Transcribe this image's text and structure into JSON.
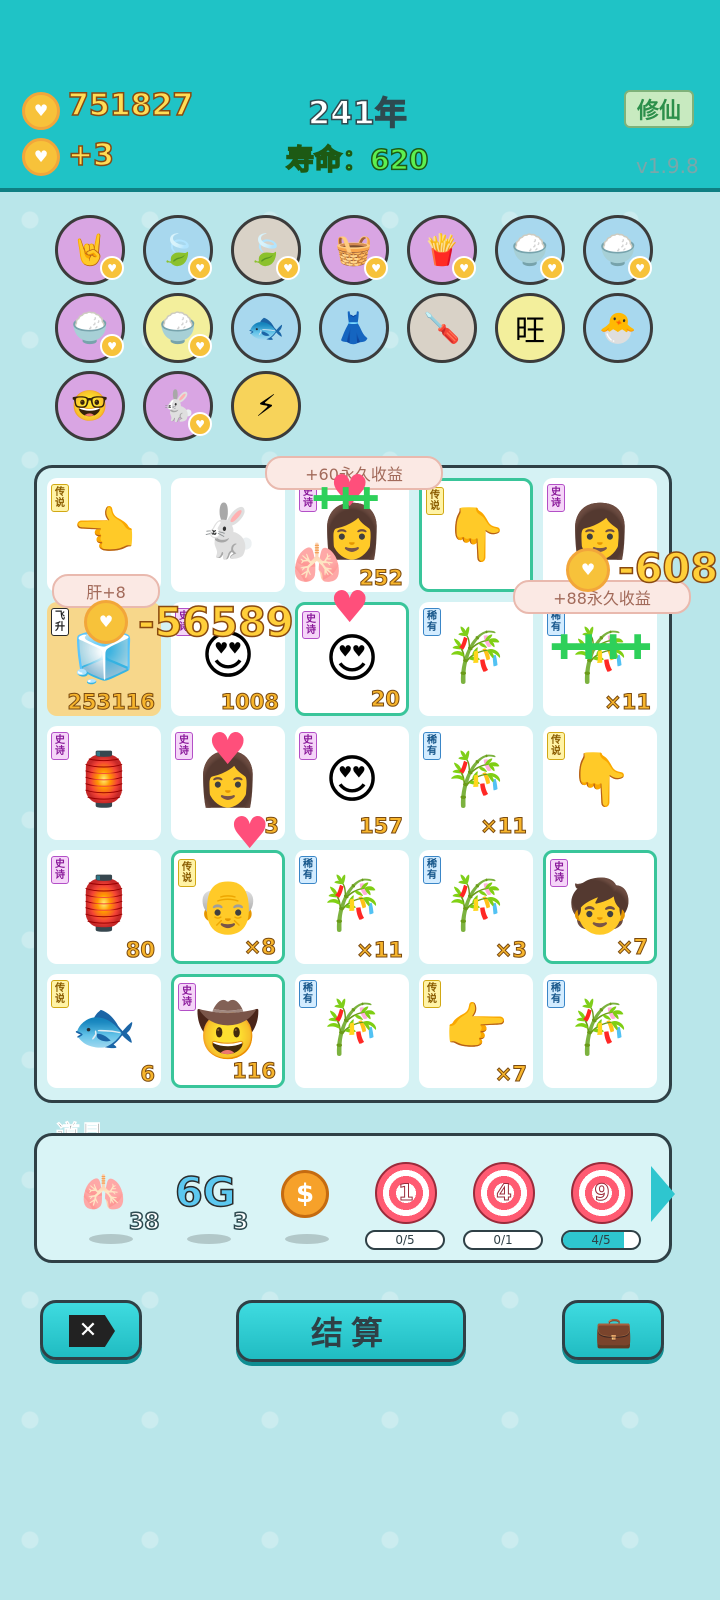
{
  "header": {
    "coins": "751827",
    "income": "+3",
    "year": "241年",
    "life_label": "寿命：",
    "life_value": "620",
    "mode_button": "修仙",
    "version": "v1.9.8"
  },
  "items": [
    {
      "icon": "rock-hand-icon",
      "glyph": "🤘",
      "bg": "#d9a5e3"
    },
    {
      "icon": "leaf-icon",
      "glyph": "🍃",
      "bg": "#a8d8ee"
    },
    {
      "icon": "leaf-icon",
      "glyph": "🍃",
      "bg": "#d9d2c7"
    },
    {
      "icon": "fruit-basket-icon",
      "glyph": "🧺",
      "bg": "#d9a5e3"
    },
    {
      "icon": "fries-icon",
      "glyph": "🍟",
      "bg": "#d9a5e3"
    },
    {
      "icon": "rice-bowl-icon",
      "glyph": "🍚",
      "bg": "#a8d8ee"
    },
    {
      "icon": "rice-bowl-icon",
      "glyph": "🍚",
      "bg": "#a8d8ee"
    },
    {
      "icon": "rice-bowl-icon",
      "glyph": "🍚",
      "bg": "#d9a5e3"
    },
    {
      "icon": "rice-bowl-icon",
      "glyph": "🍚",
      "bg": "#f3ef9c"
    },
    {
      "icon": "fish-tank-icon",
      "glyph": "🐟",
      "bg": "#a8d8ee"
    },
    {
      "icon": "skirt-icon",
      "glyph": "👗",
      "bg": "#a8d8ee"
    },
    {
      "icon": "screwdriver-icon",
      "glyph": "🪛",
      "bg": "#d9d2c7"
    },
    {
      "icon": "wang-text-icon",
      "glyph": "旺",
      "bg": "#f3ef9c"
    },
    {
      "icon": "chick-egg-icon",
      "glyph": "🐣",
      "bg": "#a8d8ee"
    },
    {
      "icon": "math-student-icon",
      "glyph": "🤓",
      "bg": "#d9a5e3"
    },
    {
      "icon": "rabbit-icon",
      "glyph": "🐇",
      "bg": "#d9a5e3"
    },
    {
      "icon": "lightning-icon",
      "glyph": "⚡",
      "bg": "#f7d35a"
    }
  ],
  "board": {
    "cells": [
      {
        "tag": "传说",
        "tagType": "leg",
        "glyph": "👈",
        "count": "",
        "sel": false,
        "gold": false,
        "icon": "pointing-hand-icon"
      },
      {
        "tag": "",
        "tagType": "",
        "glyph": "🐇",
        "count": "",
        "sel": false,
        "gold": false,
        "icon": "rabbit-icon"
      },
      {
        "tag": "史诗",
        "tagType": "epic",
        "glyph": "👩",
        "count": "252",
        "sel": false,
        "gold": false,
        "icon": "girl-face-icon"
      },
      {
        "tag": "传说",
        "tagType": "leg",
        "glyph": "👇",
        "count": "",
        "sel": true,
        "gold": false,
        "icon": "pointing-hand-icon"
      },
      {
        "tag": "史诗",
        "tagType": "epic",
        "glyph": "👩",
        "count": "",
        "sel": false,
        "gold": false,
        "icon": "girl-face-icon"
      },
      {
        "tag": "飞升",
        "tagType": "fly",
        "glyph": "🧊",
        "count": "253116",
        "sel": false,
        "gold": true,
        "icon": "fridge-icon"
      },
      {
        "tag": "史诗",
        "tagType": "epic",
        "glyph": "😍",
        "count": "1008",
        "sel": false,
        "gold": false,
        "icon": "heart-eyes-face-icon"
      },
      {
        "tag": "史诗",
        "tagType": "epic",
        "glyph": "😍",
        "count": "20",
        "sel": true,
        "gold": false,
        "icon": "heart-eyes-face-icon"
      },
      {
        "tag": "稀有",
        "tagType": "rare",
        "glyph": "🎋",
        "count": "",
        "sel": false,
        "gold": false,
        "icon": "bamboo-icon"
      },
      {
        "tag": "稀有",
        "tagType": "rare",
        "glyph": "🎋",
        "count": "×11",
        "sel": false,
        "gold": false,
        "icon": "bamboo-icon"
      },
      {
        "tag": "史诗",
        "tagType": "epic",
        "glyph": "🏮",
        "count": "",
        "sel": false,
        "gold": false,
        "icon": "rabbit-lantern-icon"
      },
      {
        "tag": "史诗",
        "tagType": "epic",
        "glyph": "👩",
        "count": "3",
        "sel": false,
        "gold": false,
        "icon": "girl-face-icon"
      },
      {
        "tag": "史诗",
        "tagType": "epic",
        "glyph": "😍",
        "count": "157",
        "sel": false,
        "gold": false,
        "icon": "old-man-face-icon"
      },
      {
        "tag": "稀有",
        "tagType": "rare",
        "glyph": "🎋",
        "count": "×11",
        "sel": false,
        "gold": false,
        "icon": "bamboo-icon"
      },
      {
        "tag": "传说",
        "tagType": "leg",
        "glyph": "👇",
        "count": "",
        "sel": false,
        "gold": false,
        "icon": "pointing-hand-icon"
      },
      {
        "tag": "史诗",
        "tagType": "epic",
        "glyph": "🏮",
        "count": "80",
        "sel": false,
        "gold": false,
        "icon": "rabbit-lantern-icon"
      },
      {
        "tag": "传说",
        "tagType": "leg",
        "glyph": "👴",
        "count": "×8",
        "sel": true,
        "gold": false,
        "icon": "grandpa-face-icon"
      },
      {
        "tag": "稀有",
        "tagType": "rare",
        "glyph": "🎋",
        "count": "×11",
        "sel": false,
        "gold": false,
        "icon": "bamboo-icon"
      },
      {
        "tag": "稀有",
        "tagType": "rare",
        "glyph": "🎋",
        "count": "×3",
        "sel": false,
        "gold": false,
        "icon": "bamboo-icon"
      },
      {
        "tag": "史诗",
        "tagType": "epic",
        "glyph": "🧒",
        "count": "×7",
        "sel": true,
        "gold": false,
        "icon": "boy-face-icon"
      },
      {
        "tag": "传说",
        "tagType": "leg",
        "glyph": "🐟",
        "count": "6",
        "sel": false,
        "gold": false,
        "icon": "koi-fish-icon"
      },
      {
        "tag": "史诗",
        "tagType": "epic",
        "glyph": "🤠",
        "count": "116",
        "sel": true,
        "gold": false,
        "icon": "cowboy-face-icon"
      },
      {
        "tag": "稀有",
        "tagType": "rare",
        "glyph": "🎋",
        "count": "",
        "sel": false,
        "gold": false,
        "icon": "bamboo-icon"
      },
      {
        "tag": "传说",
        "tagType": "leg",
        "glyph": "👉",
        "count": "×7",
        "sel": false,
        "gold": false,
        "icon": "pointing-hand-icon"
      },
      {
        "tag": "稀有",
        "tagType": "rare",
        "glyph": "🎋",
        "count": "",
        "sel": false,
        "gold": false,
        "icon": "bamboo-icon"
      }
    ],
    "popup_top": "+60永久收益",
    "popup_right": "+88永久收益",
    "popup_liver": "肝+8",
    "neg_left": "-56589",
    "neg_right": "-608"
  },
  "props": {
    "title": "道具",
    "liver_count": "38",
    "sixg_label": "6G",
    "sixg_count": "3",
    "targets": [
      {
        "num": "1",
        "progress": "0/5",
        "fill": 0
      },
      {
        "num": "4",
        "progress": "0/1",
        "fill": 0
      },
      {
        "num": "9",
        "progress": "4/5",
        "fill": 0.8
      }
    ]
  },
  "buttons": {
    "settle": "结算"
  },
  "colors": {
    "header_bg": "#1fc3c6",
    "board_bg": "#d5f2f4",
    "accent": "#2ec6cf"
  }
}
